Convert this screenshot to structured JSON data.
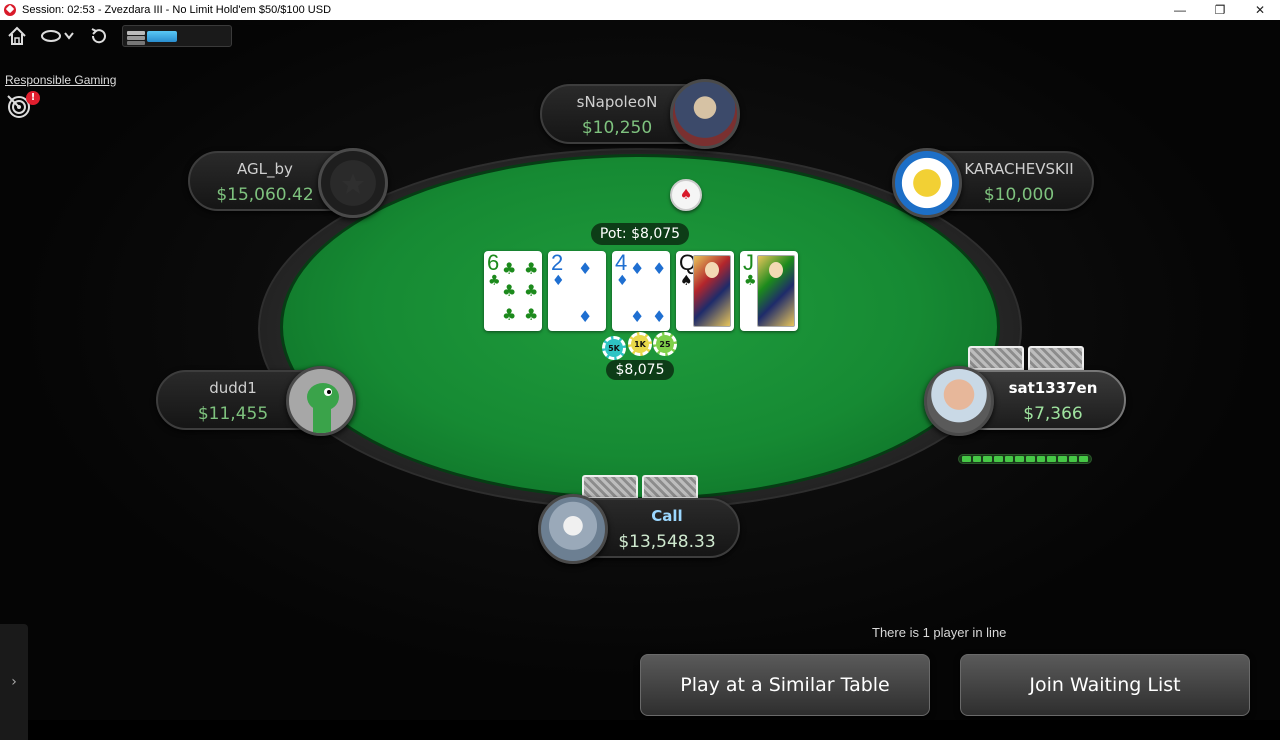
{
  "window": {
    "title": "Session: 02:53 - Zvezdara III - No Limit Hold'em $50/$100 USD",
    "controls": [
      "—",
      "❐",
      "✕"
    ]
  },
  "toolbar": {
    "icons": [
      "home-icon",
      "lobby-icon",
      "rebuy-icon",
      "chip-stack-icon"
    ],
    "progress": 0.3
  },
  "responsible_gaming": {
    "label": "Responsible Gaming",
    "badge": "!"
  },
  "table": {
    "pot_label": "Pot: $8,075",
    "bet_amount": "$8,075",
    "chips": [
      "5K",
      "1K",
      "25"
    ],
    "board": [
      {
        "rank": "6",
        "suit": "♣",
        "color": "#1c8a1c"
      },
      {
        "rank": "2",
        "suit": "♦",
        "color": "#1f6fd1"
      },
      {
        "rank": "4",
        "suit": "♦",
        "color": "#1f6fd1"
      },
      {
        "rank": "Q",
        "suit": "♠",
        "color": "#111111"
      },
      {
        "rank": "J",
        "suit": "♣",
        "color": "#1c8a1c"
      }
    ]
  },
  "players": {
    "snapoleon": {
      "name": "sNapoleoN",
      "stack": "$10,250"
    },
    "agl": {
      "name": "AGL_by",
      "stack": "$15,060.42"
    },
    "karachevskii": {
      "name": "KARACHEVSKII",
      "stack": "$10,000"
    },
    "dudd1": {
      "name": "dudd1",
      "stack": "$11,455"
    },
    "sat1337en": {
      "name": "sat1337en",
      "stack": "$7,366"
    },
    "hero": {
      "name": "Call",
      "stack": "$13,548.33"
    }
  },
  "waiting": {
    "in_line": "There is 1 player in line",
    "play_similar": "Play at a Similar Table",
    "join_waiting": "Join Waiting List"
  },
  "side_tab": "›"
}
